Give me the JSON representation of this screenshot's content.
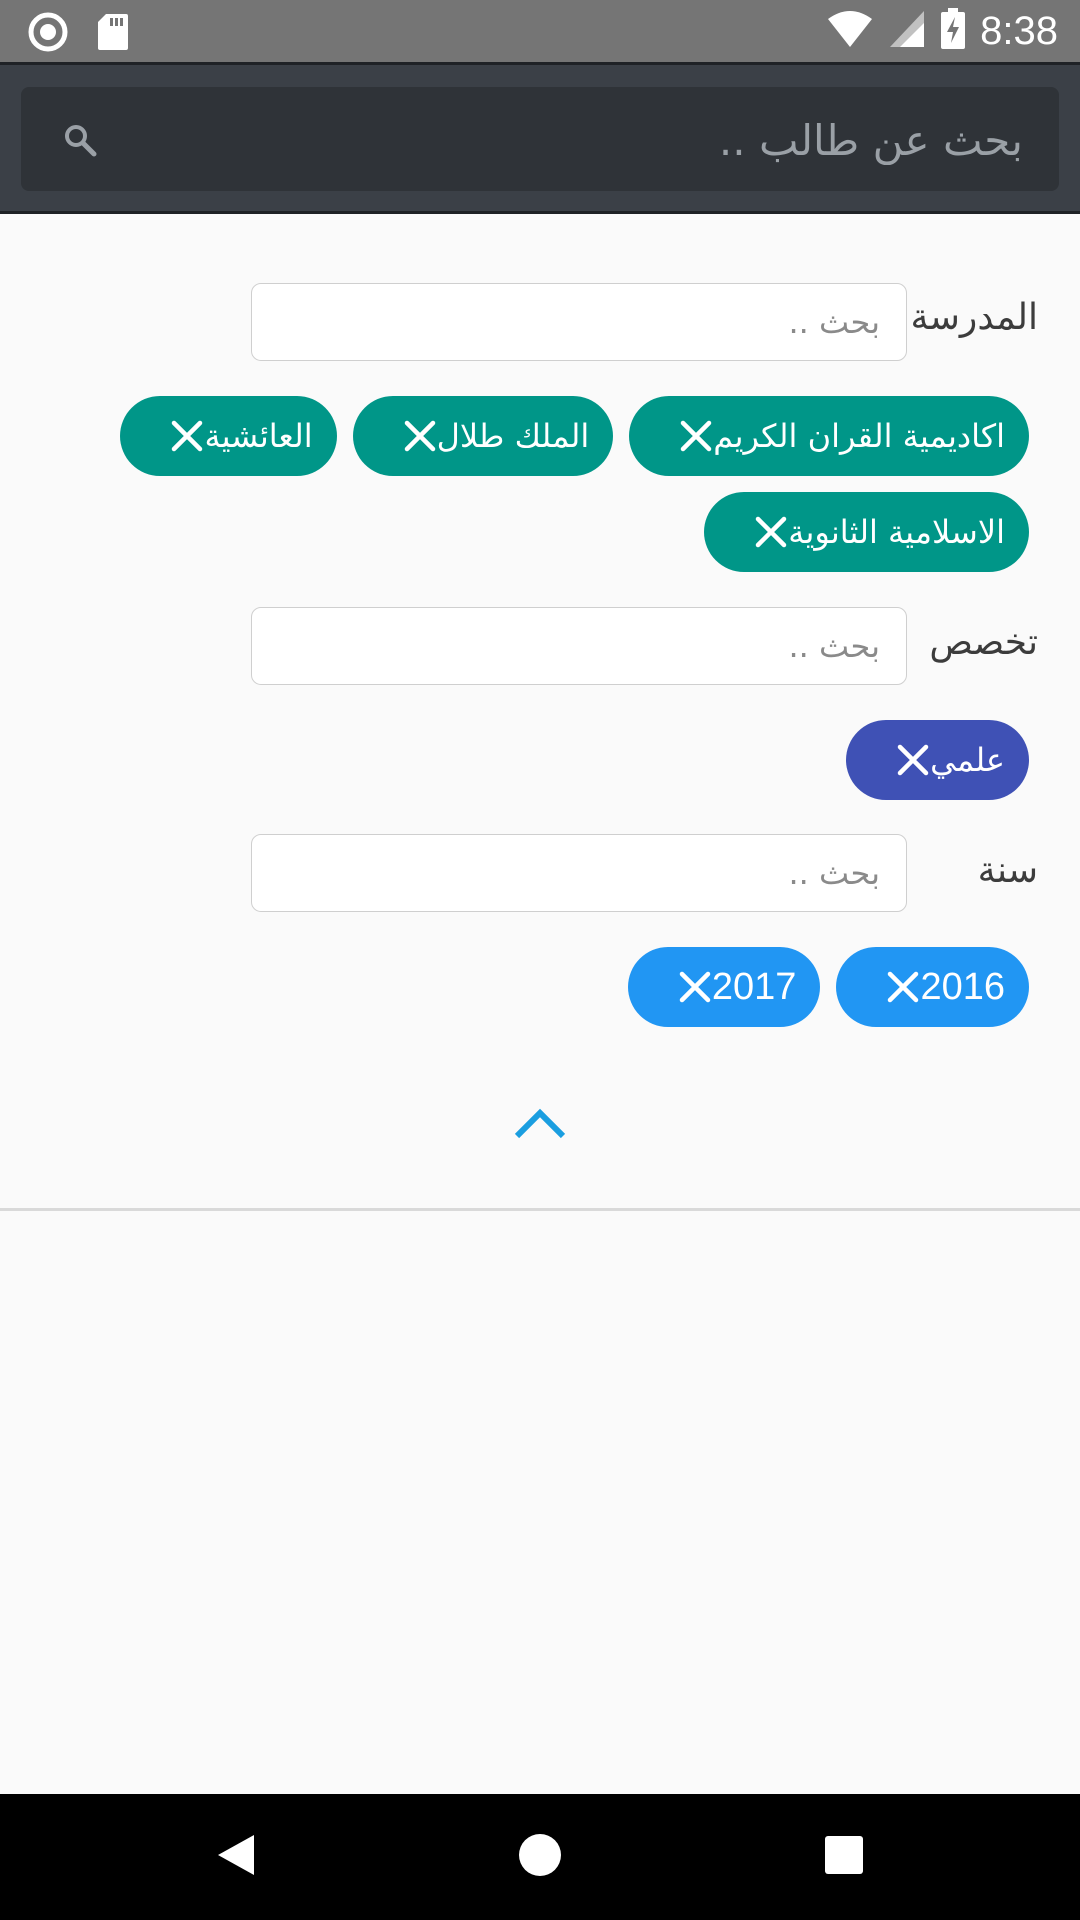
{
  "status_bar": {
    "time": "8:38",
    "icons": [
      "record-icon",
      "sd-card-icon",
      "wifi-icon",
      "signal-icon",
      "battery-charging-icon"
    ]
  },
  "search": {
    "placeholder": "بحث عن طالب .."
  },
  "filters": {
    "school": {
      "label": "المدرسة",
      "placeholder": "بحث ..",
      "chips": [
        "اكاديمية القران الكريم",
        "الملك طلال",
        "العائشية",
        "الاسلامية الثانوية"
      ]
    },
    "specialization": {
      "label": "تخصص",
      "placeholder": "بحث ..",
      "chips": [
        "علمي"
      ]
    },
    "year": {
      "label": "سنة",
      "placeholder": "بحث ..",
      "chips": [
        "2016",
        "2017"
      ]
    }
  },
  "colors": {
    "school_chip": "#009688",
    "specialization_chip": "#3f51b5",
    "year_chip": "#2196f3",
    "collapse_arrow": "#1a9ee0",
    "app_bar": "#3b4047"
  }
}
